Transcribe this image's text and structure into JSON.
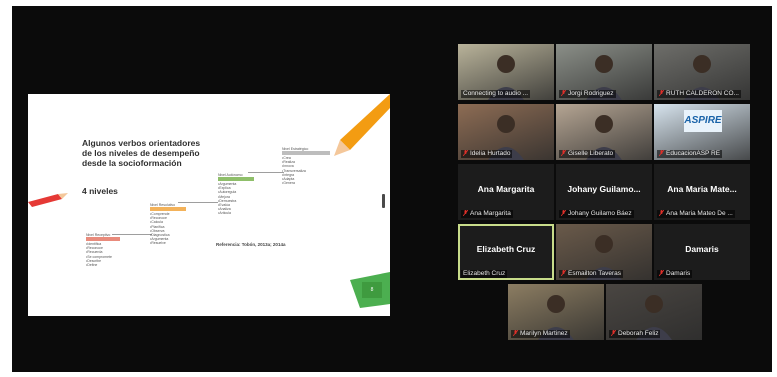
{
  "slide": {
    "title": "Algunos verbos orientadores de los niveles de desempeño desde la socioformación",
    "subtitle": "4 niveles",
    "steps": [
      {
        "label": "Nivel Receptivo",
        "color": "#e98b7c",
        "items": [
          "Identifica",
          "Reconoce",
          "Recuerda",
          "Se compromete",
          "Describe",
          "Define"
        ]
      },
      {
        "label": "Nivel Resolutivo",
        "color": "#f3b25a",
        "items": [
          "Comprende",
          "Reconoce",
          "Calcula",
          "Planifica",
          "Observa",
          "Diagnostica",
          "Argumenta",
          "Resuelve"
        ]
      },
      {
        "label": "Nivel Autónomo",
        "color": "#8fbf6a",
        "items": [
          "Argumenta",
          "Explica",
          "Autoregula",
          "Mejora",
          "Demuestra",
          "Evalúa",
          "Analiza",
          "Articula"
        ]
      },
      {
        "label": "Nivel Estratégico",
        "color": "#bdbdbd",
        "items": [
          "Crea",
          "Realiza",
          "Innova",
          "Transversaliza",
          "Integra",
          "Adapta",
          "Genera"
        ]
      }
    ],
    "reference": "Referencia: Tobón, 2013a; 2014a",
    "page": "8"
  },
  "participants": [
    {
      "label": "Connecting to audio ...",
      "muted": false,
      "video": true
    },
    {
      "label": "Jorgi Rodriguez",
      "muted": true,
      "video": true
    },
    {
      "label": "RUTH CALDERON CO...",
      "muted": true,
      "video": true
    },
    {
      "label": "Idelia Hurtado",
      "muted": true,
      "video": true
    },
    {
      "label": "Giselle Liberato",
      "muted": true,
      "video": true
    },
    {
      "label": "EducacionASP RE",
      "muted": true,
      "video": true,
      "logo": "ASPIRE"
    },
    {
      "name": "Ana Margarita",
      "label": "Ana Margarita",
      "muted": true,
      "video": false
    },
    {
      "name": "Johany Guilamo...",
      "label": "Johany Guilamo Báez",
      "muted": true,
      "video": false
    },
    {
      "name": "Ana Maria Mate...",
      "label": "Ana Maria Mateo De ...",
      "muted": true,
      "video": false
    },
    {
      "name": "Elizabeth Cruz",
      "label": "Elizabeth Cruz",
      "muted": false,
      "video": false,
      "active": true
    },
    {
      "label": "Esmailton Taveras",
      "muted": true,
      "video": true
    },
    {
      "name": "Damaris",
      "label": "Damaris",
      "muted": true,
      "video": false
    },
    {
      "label": "Marilyn Martinez",
      "muted": true,
      "video": true
    },
    {
      "label": "Deborah Feliz",
      "muted": true,
      "video": true
    }
  ],
  "colors": {
    "mute": "#e0302a",
    "active_border": "#c8dc8a",
    "background": "#0b0b0b"
  }
}
